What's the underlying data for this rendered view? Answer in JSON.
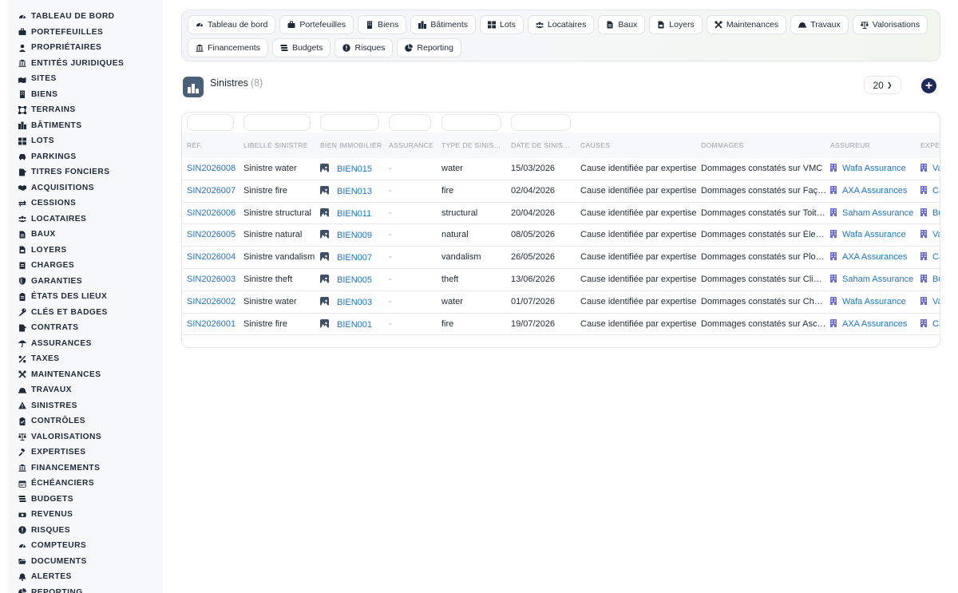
{
  "sidebar": {
    "items": [
      {
        "label": "TABLEAU DE BORD",
        "icon": "gauge-icon"
      },
      {
        "label": "PORTEFEUILLES",
        "icon": "briefcase-icon"
      },
      {
        "label": "PROPRIÉTAIRES",
        "icon": "user-icon"
      },
      {
        "label": "ENTITÉS JURIDIQUES",
        "icon": "landmark-icon"
      },
      {
        "label": "SITES",
        "icon": "map-location-icon"
      },
      {
        "label": "BIENS",
        "icon": "building-icon"
      },
      {
        "label": "TERRAINS",
        "icon": "vector-square-icon"
      },
      {
        "label": "BÂTIMENTS",
        "icon": "city-icon"
      },
      {
        "label": "LOTS",
        "icon": "grid-icon"
      },
      {
        "label": "PARKINGS",
        "icon": "car-icon"
      },
      {
        "label": "TITRES FONCIERS",
        "icon": "file-signature-icon"
      },
      {
        "label": "ACQUISITIONS",
        "icon": "handshake-icon"
      },
      {
        "label": "CESSIONS",
        "icon": "exchange-icon"
      },
      {
        "label": "LOCATAIRES",
        "icon": "users-icon"
      },
      {
        "label": "BAUX",
        "icon": "file-contract-icon"
      },
      {
        "label": "LOYERS",
        "icon": "file-invoice-icon"
      },
      {
        "label": "CHARGES",
        "icon": "receipt-icon"
      },
      {
        "label": "GARANTIES",
        "icon": "shield-icon"
      },
      {
        "label": "ÉTATS DES LIEUX",
        "icon": "clipboard-list-icon"
      },
      {
        "label": "CLÉS ET BADGES",
        "icon": "key-icon"
      },
      {
        "label": "CONTRATS",
        "icon": "file-signature-icon"
      },
      {
        "label": "ASSURANCES",
        "icon": "umbrella-icon"
      },
      {
        "label": "TAXES",
        "icon": "percent-icon"
      },
      {
        "label": "MAINTENANCES",
        "icon": "tools-icon"
      },
      {
        "label": "TRAVAUX",
        "icon": "helmet-icon"
      },
      {
        "label": "SINISTRES",
        "icon": "warning-icon"
      },
      {
        "label": "CONTRÔLES",
        "icon": "clipboard-check-icon"
      },
      {
        "label": "VALORISATIONS",
        "icon": "scale-icon"
      },
      {
        "label": "EXPERTISES",
        "icon": "gavel-icon"
      },
      {
        "label": "FINANCEMENTS",
        "icon": "landmark-icon"
      },
      {
        "label": "ÉCHÉANCIERS",
        "icon": "calendar-icon"
      },
      {
        "label": "BUDGETS",
        "icon": "money-stack-icon"
      },
      {
        "label": "REVENUS",
        "icon": "money-bill-icon"
      },
      {
        "label": "RISQUES",
        "icon": "exclamation-circle-icon"
      },
      {
        "label": "COMPTEURS",
        "icon": "gauge-icon"
      },
      {
        "label": "DOCUMENTS",
        "icon": "folder-open-icon"
      },
      {
        "label": "ALERTES",
        "icon": "bell-icon"
      },
      {
        "label": "REPORTING",
        "icon": "chart-pie-icon"
      }
    ]
  },
  "topnav": {
    "rows": [
      [
        {
          "label": "Tableau de bord",
          "icon": "gauge-icon"
        },
        {
          "label": "Portefeuilles",
          "icon": "briefcase-icon"
        },
        {
          "label": "Biens",
          "icon": "building-icon"
        },
        {
          "label": "Bâtiments",
          "icon": "city-icon"
        },
        {
          "label": "Lots",
          "icon": "grid-icon"
        },
        {
          "label": "Locataires",
          "icon": "users-icon"
        },
        {
          "label": "Baux",
          "icon": "file-contract-icon"
        },
        {
          "label": "Loyers",
          "icon": "file-invoice-icon"
        },
        {
          "label": "Maintenances",
          "icon": "tools-icon"
        },
        {
          "label": "Travaux",
          "icon": "helmet-icon"
        },
        {
          "label": "Valorisations",
          "icon": "scale-icon"
        }
      ],
      [
        {
          "label": "Financements",
          "icon": "landmark-icon"
        },
        {
          "label": "Budgets",
          "icon": "money-stack-icon"
        },
        {
          "label": "Risques",
          "icon": "exclamation-circle-icon"
        },
        {
          "label": "Reporting",
          "icon": "chart-pie-icon"
        }
      ]
    ]
  },
  "header": {
    "title": "Sinistres",
    "count": "(8)",
    "per_page": "20",
    "icon": "city-icon"
  },
  "table": {
    "columns": [
      "RÉF.",
      "LIBELLÉ SINISTRE",
      "BIEN IMMOBILIER",
      "ASSURANCE",
      "TYPE DE SINIS…",
      "DATE DE SINIS…",
      "CAUSES",
      "DOMMAGES",
      "ASSUREUR",
      "EXPER"
    ],
    "rows": [
      {
        "ref": "SIN2026008",
        "libelle": "Sinistre water",
        "bien": "BIEN015",
        "assurance": "-",
        "type": "water",
        "date": "15/03/2026",
        "causes": "Cause identifiée par expertise",
        "dommages": "Dommages constatés sur VMC",
        "assureur": "Wafa Assurance",
        "expert": "Va"
      },
      {
        "ref": "SIN2026007",
        "libelle": "Sinistre fire",
        "bien": "BIEN013",
        "assurance": "-",
        "type": "fire",
        "date": "02/04/2026",
        "causes": "Cause identifiée par expertise",
        "dommages": "Dommages constatés sur Faç…",
        "assureur": "AXA Assurances",
        "expert": "Ca"
      },
      {
        "ref": "SIN2026006",
        "libelle": "Sinistre structural",
        "bien": "BIEN011",
        "assurance": "-",
        "type": "structural",
        "date": "20/04/2026",
        "causes": "Cause identifiée par expertise",
        "dommages": "Dommages constatés sur Toit…",
        "assureur": "Saham Assurance",
        "expert": "Bu"
      },
      {
        "ref": "SIN2026005",
        "libelle": "Sinistre natural",
        "bien": "BIEN009",
        "assurance": "-",
        "type": "natural",
        "date": "08/05/2026",
        "causes": "Cause identifiée par expertise",
        "dommages": "Dommages constatés sur Éle…",
        "assureur": "Wafa Assurance",
        "expert": "Va"
      },
      {
        "ref": "SIN2026004",
        "libelle": "Sinistre vandalism",
        "bien": "BIEN007",
        "assurance": "-",
        "type": "vandalism",
        "date": "26/05/2026",
        "causes": "Cause identifiée par expertise",
        "dommages": "Dommages constatés sur Plo…",
        "assureur": "AXA Assurances",
        "expert": "Ca"
      },
      {
        "ref": "SIN2026003",
        "libelle": "Sinistre theft",
        "bien": "BIEN005",
        "assurance": "-",
        "type": "theft",
        "date": "13/06/2026",
        "causes": "Cause identifiée par expertise",
        "dommages": "Dommages constatés sur Cli…",
        "assureur": "Saham Assurance",
        "expert": "Bu"
      },
      {
        "ref": "SIN2026002",
        "libelle": "Sinistre water",
        "bien": "BIEN003",
        "assurance": "-",
        "type": "water",
        "date": "01/07/2026",
        "causes": "Cause identifiée par expertise",
        "dommages": "Dommages constatés sur Ch…",
        "assureur": "Wafa Assurance",
        "expert": "Va"
      },
      {
        "ref": "SIN2026001",
        "libelle": "Sinistre fire",
        "bien": "BIEN001",
        "assurance": "-",
        "type": "fire",
        "date": "19/07/2026",
        "causes": "Cause identifiée par expertise",
        "dommages": "Dommages constatés sur Asc…",
        "assureur": "AXA Assurances",
        "expert": "Ca"
      }
    ]
  },
  "colors": {
    "link": "#1b74c9",
    "accent": "#1e2a5a",
    "muted": "#9aa1ab"
  }
}
